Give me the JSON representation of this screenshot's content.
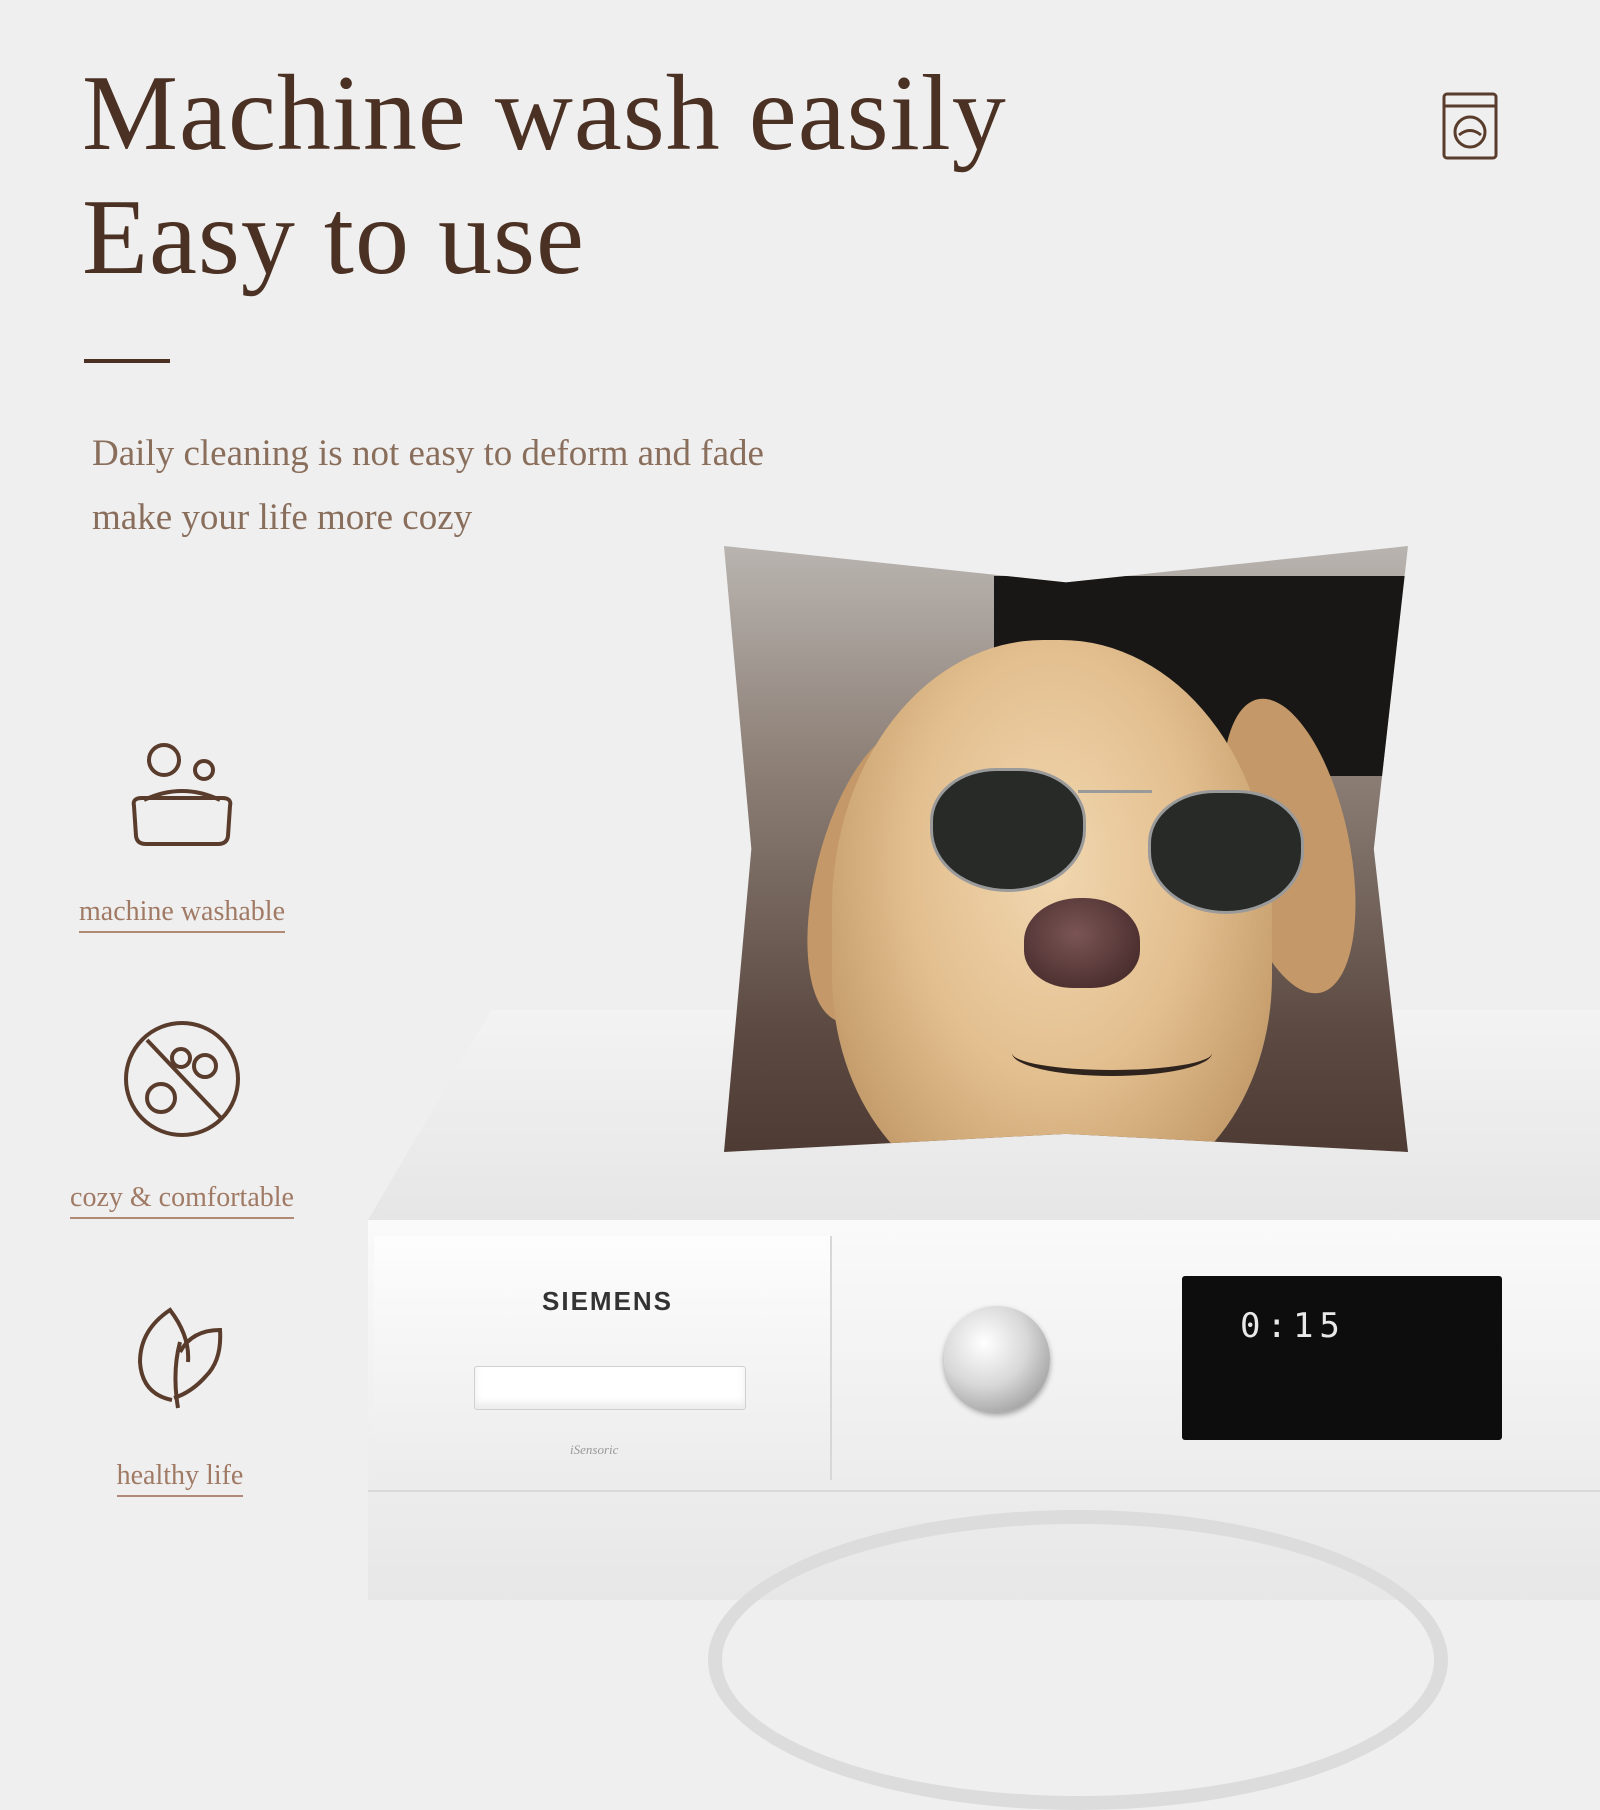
{
  "header": {
    "title_line_1": "Machine wash easily",
    "title_line_2": "Easy to use"
  },
  "description": {
    "line_1": "Daily cleaning is not easy to deform and fade",
    "line_2": "make your life more cozy"
  },
  "features": [
    {
      "label": "machine washable",
      "icon": "soap-bubbles-icon"
    },
    {
      "label": "cozy & comfortable",
      "icon": "no-pilling-icon"
    },
    {
      "label": "healthy life",
      "icon": "leaf-icon"
    }
  ],
  "corner_icon": "washing-machine-icon",
  "product_photo": {
    "machine_brand": "SIEMENS",
    "machine_badge": "iSensoric",
    "display_time": "0:15"
  },
  "colors": {
    "background": "#efefef",
    "heading": "#4b3123",
    "body_text": "#8a6e5c",
    "feature_text": "#a07a64"
  }
}
